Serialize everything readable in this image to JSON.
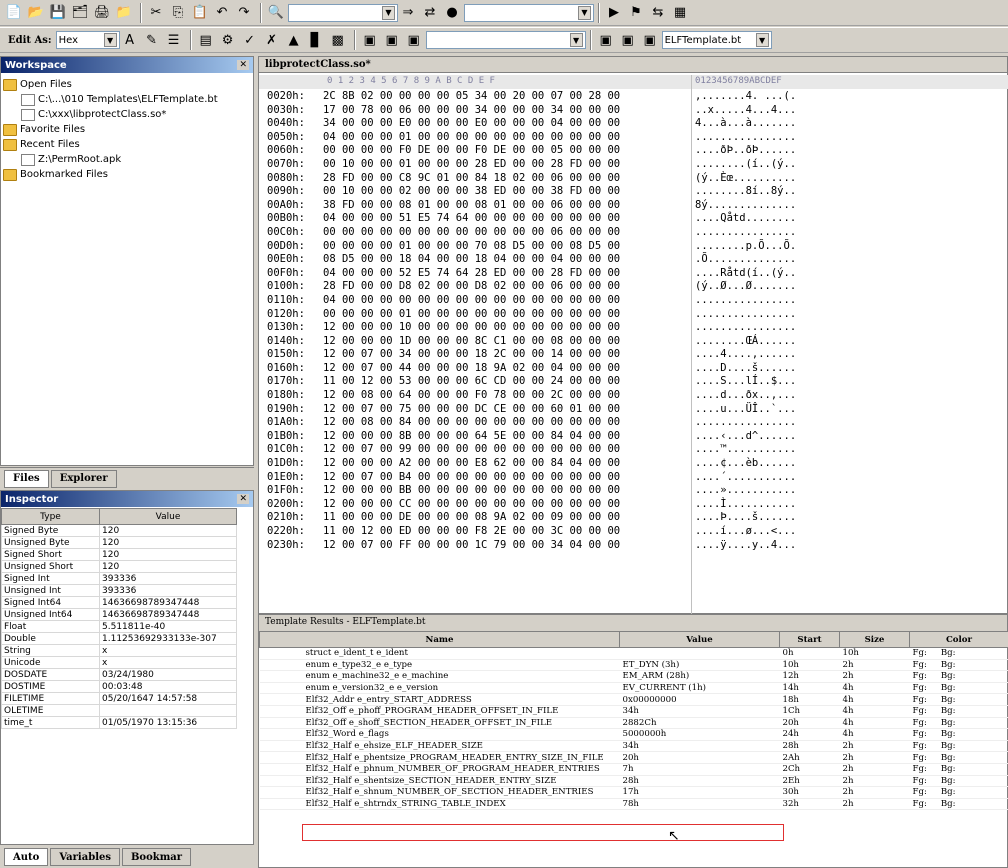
{
  "toolbar2": {
    "edit_as_label": "Edit As:",
    "edit_as_value": "Hex",
    "template_value": "ELFTemplate.bt"
  },
  "workspace": {
    "title": "Workspace",
    "open_files": "Open Files",
    "file1": "C:\\...\\010 Templates\\ELFTemplate.bt",
    "file2": "C:\\xxx\\libprotectClass.so*",
    "favorite": "Favorite Files",
    "recent": "Recent Files",
    "recent1": "Z:\\PermRoot.apk",
    "bookmarked": "Bookmarked Files"
  },
  "workspace_tabs": {
    "files": "Files",
    "explorer": "Explorer"
  },
  "inspector": {
    "title": "Inspector",
    "col_type": "Type",
    "col_value": "Value",
    "rows": [
      [
        "Signed Byte",
        "120"
      ],
      [
        "Unsigned Byte",
        "120"
      ],
      [
        "Signed Short",
        "120"
      ],
      [
        "Unsigned Short",
        "120"
      ],
      [
        "Signed Int",
        "393336"
      ],
      [
        "Unsigned Int",
        "393336"
      ],
      [
        "Signed Int64",
        "14636698789347448"
      ],
      [
        "Unsigned Int64",
        "14636698789347448"
      ],
      [
        "Float",
        "5.511811e-40"
      ],
      [
        "Double",
        "1.11253692933133e-307"
      ],
      [
        "String",
        "x"
      ],
      [
        "Unicode",
        "x"
      ],
      [
        "DOSDATE",
        "03/24/1980"
      ],
      [
        "DOSTIME",
        "00:03:48"
      ],
      [
        "FILETIME",
        "05/20/1647 14:57:58"
      ],
      [
        "OLETIME",
        ""
      ],
      [
        "time_t",
        "01/05/1970 13:15:36"
      ]
    ]
  },
  "bottom_tabs": {
    "auto": "Auto",
    "variables": "Variables",
    "bookmarks": "Bookmar"
  },
  "editor": {
    "tab": "libprotectClass.so*",
    "hex_header": "0  1  2  3  4  5  6  7  8  9  A  B  C  D  E  F",
    "ascii_header": "0123456789ABCDEF",
    "rows": [
      [
        "0020h:",
        "2C 8B 02 00 00 00 00 05 34 00 20 00 07 00 28 00",
        ",.......4. ...(."
      ],
      [
        "0030h:",
        "17 00 78 00 06 00 00 00 34 00 00 00 34 00 00 00",
        "..x.....4...4..."
      ],
      [
        "0040h:",
        "34 00 00 00 E0 00 00 00 E0 00 00 00 04 00 00 00",
        "4...à...à......."
      ],
      [
        "0050h:",
        "04 00 00 00 01 00 00 00 00 00 00 00 00 00 00 00",
        "................"
      ],
      [
        "0060h:",
        "00 00 00 00 F0 DE 00 00 F0 DE 00 00 05 00 00 00",
        "....ðÞ..ðÞ......"
      ],
      [
        "0070h:",
        "00 10 00 00 01 00 00 00 28 ED 00 00 28 FD 00 00",
        "........(í..(ý.."
      ],
      [
        "0080h:",
        "28 FD 00 00 C8 9C 01 00 84 18 02 00 06 00 00 00",
        "(ý..Èœ.........."
      ],
      [
        "0090h:",
        "00 10 00 00 02 00 00 00 38 ED 00 00 38 FD 00 00",
        "........8í..8ý.."
      ],
      [
        "00A0h:",
        "38 FD 00 00 08 01 00 00 08 01 00 00 06 00 00 00",
        "8ý.............."
      ],
      [
        "00B0h:",
        "04 00 00 00 51 E5 74 64 00 00 00 00 00 00 00 00",
        "....Qåtd........"
      ],
      [
        "00C0h:",
        "00 00 00 00 00 00 00 00 00 00 00 00 06 00 00 00",
        "................"
      ],
      [
        "00D0h:",
        "00 00 00 00 01 00 00 00 70 08 D5 00 00 08 D5 00",
        "........p.Õ...Õ."
      ],
      [
        "00E0h:",
        "08 D5 00 00 18 04 00 00 18 04 00 00 04 00 00 00",
        ".Õ.............."
      ],
      [
        "00F0h:",
        "04 00 00 00 52 E5 74 64 28 ED 00 00 28 FD 00 00",
        "....Råtd(í..(ý.."
      ],
      [
        "0100h:",
        "28 FD 00 00 D8 02 00 00 D8 02 00 00 06 00 00 00",
        "(ý..Ø...Ø......."
      ],
      [
        "0110h:",
        "04 00 00 00 00 00 00 00 00 00 00 00 00 00 00 00",
        "................"
      ],
      [
        "0120h:",
        "00 00 00 00 01 00 00 00 00 00 00 00 00 00 00 00",
        "................"
      ],
      [
        "0130h:",
        "12 00 00 00 10 00 00 00 00 00 00 00 00 00 00 00",
        "................"
      ],
      [
        "0140h:",
        "12 00 00 00 1D 00 00 00 8C C1 00 00 08 00 00 00",
        "........ŒÁ......"
      ],
      [
        "0150h:",
        "12 00 07 00 34 00 00 00 18 2C 00 00 14 00 00 00",
        "....4....,......"
      ],
      [
        "0160h:",
        "12 00 07 00 44 00 00 00 18 9A 02 00 04 00 00 00",
        "....D....š......"
      ],
      [
        "0170h:",
        "11 00 12 00 53 00 00 00 6C CD 00 00 24 00 00 00",
        "....S...lÍ..$..."
      ],
      [
        "0180h:",
        "12 00 08 00 64 00 00 00 F0 78 00 00 2C 00 00 00",
        "....d...ðx..,..."
      ],
      [
        "0190h:",
        "12 00 07 00 75 00 00 00 DC CE 00 00 60 01 00 00",
        "....u...ÜÎ..`..."
      ],
      [
        "01A0h:",
        "12 00 08 00 84 00 00 00 00 00 00 00 00 00 00 00",
        "................"
      ],
      [
        "01B0h:",
        "12 00 00 00 8B 00 00 00 64 5E 00 00 84 04 00 00",
        "....‹...d^......"
      ],
      [
        "01C0h:",
        "12 00 07 00 99 00 00 00 00 00 00 00 00 00 00 00",
        "....™..........."
      ],
      [
        "01D0h:",
        "12 00 00 00 A2 00 00 00 E8 62 00 00 84 04 00 00",
        "....¢...èb......"
      ],
      [
        "01E0h:",
        "12 00 07 00 B4 00 00 00 00 00 00 00 00 00 00 00",
        "....´..........."
      ],
      [
        "01F0h:",
        "12 00 00 00 BB 00 00 00 00 00 00 00 00 00 00 00",
        "....»..........."
      ],
      [
        "0200h:",
        "12 00 00 00 CC 00 00 00 00 00 00 00 00 00 00 00",
        "....Ì..........."
      ],
      [
        "0210h:",
        "11 00 00 00 DE 00 00 00 08 9A 02 00 09 00 00 00",
        "....Þ....š......"
      ],
      [
        "0220h:",
        "11 00 12 00 ED 00 00 00 F8 2E 00 00 3C 00 00 00",
        "....í...ø...<..."
      ],
      [
        "0230h:",
        "12 00 07 00 FF 00 00 00 1C 79 00 00 34 04 00 00",
        "....ÿ....y..4..."
      ]
    ]
  },
  "results": {
    "title": "Template Results - ELFTemplate.bt",
    "col_name": "Name",
    "col_value": "Value",
    "col_start": "Start",
    "col_size": "Size",
    "col_color": "Color",
    "rows": [
      [
        "struct e_ident_t e_ident",
        "",
        "0h",
        "10h",
        "Fg:",
        "Bg:"
      ],
      [
        "enum e_type32_e e_type",
        "ET_DYN (3h)",
        "10h",
        "2h",
        "Fg:",
        "Bg:"
      ],
      [
        "enum e_machine32_e e_machine",
        "EM_ARM (28h)",
        "12h",
        "2h",
        "Fg:",
        "Bg:"
      ],
      [
        "enum e_version32_e e_version",
        "EV_CURRENT (1h)",
        "14h",
        "4h",
        "Fg:",
        "Bg:"
      ],
      [
        "Elf32_Addr e_entry_START_ADDRESS",
        "0x00000000",
        "18h",
        "4h",
        "Fg:",
        "Bg:"
      ],
      [
        "Elf32_Off e_phoff_PROGRAM_HEADER_OFFSET_IN_FILE",
        "34h",
        "1Ch",
        "4h",
        "Fg:",
        "Bg:"
      ],
      [
        "Elf32_Off e_shoff_SECTION_HEADER_OFFSET_IN_FILE",
        "2882Ch",
        "20h",
        "4h",
        "Fg:",
        "Bg:"
      ],
      [
        "Elf32_Word e_flags",
        "5000000h",
        "24h",
        "4h",
        "Fg:",
        "Bg:"
      ],
      [
        "Elf32_Half e_ehsize_ELF_HEADER_SIZE",
        "34h",
        "28h",
        "2h",
        "Fg:",
        "Bg:"
      ],
      [
        "Elf32_Half e_phentsize_PROGRAM_HEADER_ENTRY_SIZE_IN_FILE",
        "20h",
        "2Ah",
        "2h",
        "Fg:",
        "Bg:"
      ],
      [
        "Elf32_Half e_phnum_NUMBER_OF_PROGRAM_HEADER_ENTRIES",
        "7h",
        "2Ch",
        "2h",
        "Fg:",
        "Bg:"
      ],
      [
        "Elf32_Half e_shentsize_SECTION_HEADER_ENTRY_SIZE",
        "28h",
        "2Eh",
        "2h",
        "Fg:",
        "Bg:"
      ],
      [
        "Elf32_Half e_shnum_NUMBER_OF_SECTION_HEADER_ENTRIES",
        "17h",
        "30h",
        "2h",
        "Fg:",
        "Bg:"
      ],
      [
        "Elf32_Half e_shtrndx_STRING_TABLE_INDEX",
        "78h",
        "32h",
        "2h",
        "Fg:",
        "Bg:"
      ]
    ]
  }
}
